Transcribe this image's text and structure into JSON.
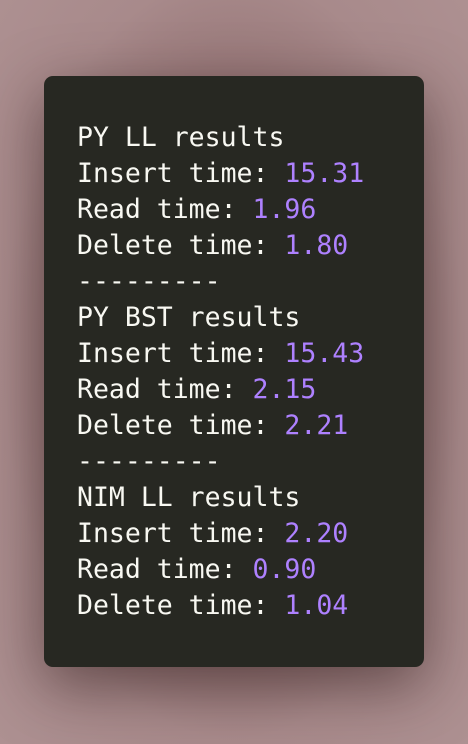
{
  "colors": {
    "text": "#f8f8f2",
    "number": "#ae81ff",
    "terminal_background": "#272822",
    "page_background": "#a88a8b"
  },
  "lines": [
    {
      "label": "PY LL results",
      "value": ""
    },
    {
      "label": "Insert time: ",
      "value": "15.31"
    },
    {
      "label": "Read time: ",
      "value": "1.96"
    },
    {
      "label": "Delete time: ",
      "value": "1.80"
    },
    {
      "label": "---------",
      "value": ""
    },
    {
      "label": "PY BST results",
      "value": ""
    },
    {
      "label": "Insert time: ",
      "value": "15.43"
    },
    {
      "label": "Read time: ",
      "value": "2.15"
    },
    {
      "label": "Delete time: ",
      "value": "2.21"
    },
    {
      "label": "---------",
      "value": ""
    },
    {
      "label": "NIM LL results",
      "value": ""
    },
    {
      "label": "Insert time: ",
      "value": "2.20"
    },
    {
      "label": "Read time: ",
      "value": "0.90"
    },
    {
      "label": "Delete time: ",
      "value": "1.04"
    }
  ]
}
